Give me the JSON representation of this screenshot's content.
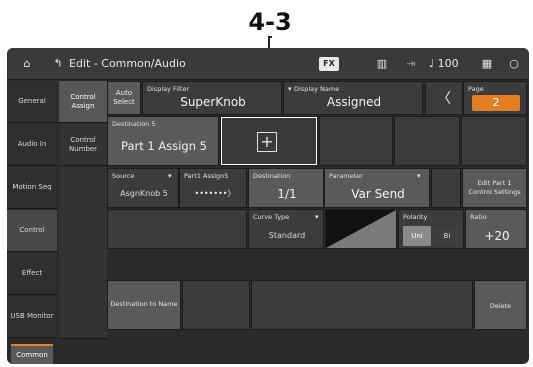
{
  "callout": {
    "label": "4-3"
  },
  "topbar": {
    "title": "Edit - Common/Audio",
    "fx_badge": "FX",
    "tempo": "♩ 100"
  },
  "sidebar": {
    "items": [
      {
        "label": "General"
      },
      {
        "label": "Audio In"
      },
      {
        "label": "Motion Seq"
      },
      {
        "label": "Control"
      },
      {
        "label": "Effect"
      },
      {
        "label": "USB Monitor"
      }
    ]
  },
  "subtabs": [
    {
      "label": "Control Assign"
    },
    {
      "label": "Control Number"
    }
  ],
  "filters": {
    "auto_select": "Auto Select",
    "display_filter_label": "Display Filter",
    "display_filter_value": "SuperKnob",
    "display_name_label": "Display Name",
    "display_name_value": "Assigned",
    "page_label": "Page",
    "page_value": "2"
  },
  "destination": {
    "label": "Destination 5",
    "value": "Part 1 Assign 5"
  },
  "table": {
    "source_header": "Source",
    "part_header": "Part1 Assign5",
    "destination_header": "Destination",
    "parameter_header": "Parameter",
    "source_value": "AsgnKnob 5",
    "dots": "•••••••〉",
    "destination_value": "1/1",
    "parameter_value": "Var Send",
    "edit_part": "Edit Part 1 Control Settings",
    "curve_type_label": "Curve Type",
    "curve_type_value": "Standard",
    "polarity_label": "Polarity",
    "polarity_uni": "Uni",
    "polarity_bi": "Bi",
    "ratio_label": "Ratio",
    "ratio_value": "+20",
    "destination_to_name": "Destination to Name",
    "delete": "Delete",
    "common": "Common"
  },
  "colors": {
    "accent": "#e37f22"
  }
}
